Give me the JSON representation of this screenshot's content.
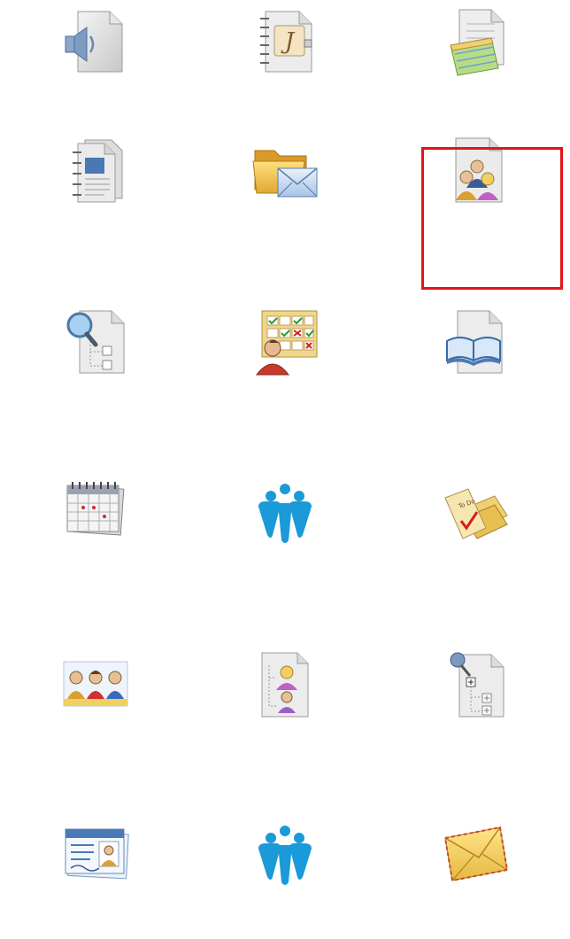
{
  "grid": {
    "icons": [
      {
        "name": "audio-file-icon"
      },
      {
        "name": "journal-notebook-icon"
      },
      {
        "name": "notes-clipboard-icon"
      },
      {
        "name": "spiral-documents-icon"
      },
      {
        "name": "folder-mail-icon"
      },
      {
        "name": "contacts-group-file-icon",
        "selected": true
      },
      {
        "name": "search-tree-file-icon"
      },
      {
        "name": "task-checklist-person-icon"
      },
      {
        "name": "book-file-icon"
      },
      {
        "name": "calendar-icon"
      },
      {
        "name": "people-group-logo-icon"
      },
      {
        "name": "letters-stack-icon"
      },
      {
        "name": "team-members-icon"
      },
      {
        "name": "org-chart-file-icon"
      },
      {
        "name": "pinned-tree-file-icon"
      },
      {
        "name": "id-card-icon"
      },
      {
        "name": "people-group-logo-icon"
      },
      {
        "name": "envelope-icon"
      }
    ]
  },
  "colors": {
    "selection_border": "#e0151b",
    "logo_blue": "#1a9ad8",
    "folder_yellow": "#f2c24a"
  }
}
